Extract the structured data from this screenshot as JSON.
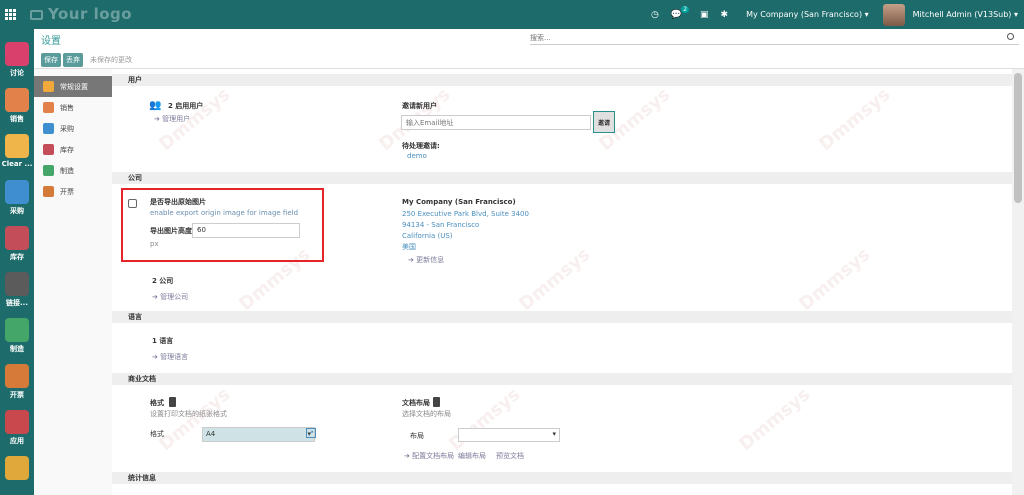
{
  "topbar": {
    "logo": "Your logo",
    "badge_count": "2",
    "company": "My Company (San Francisco)",
    "user": "Mitchell Admin (V13Sub)"
  },
  "apps": [
    {
      "label": "讨论",
      "color": "#d9416c"
    },
    {
      "label": "销售",
      "color": "#e2824a"
    },
    {
      "label": "Clear ...",
      "color": "#f0b54a"
    },
    {
      "label": "采购",
      "color": "#3f8fd0"
    },
    {
      "label": "库存",
      "color": "#c44d5a"
    },
    {
      "label": "链接...",
      "color": "#5b5b5b"
    },
    {
      "label": "制造",
      "color": "#45a66a"
    },
    {
      "label": "开票",
      "color": "#d67a3a"
    },
    {
      "label": "应用",
      "color": "#c8484d"
    },
    {
      "label": "",
      "color": "#e0a83a"
    }
  ],
  "control_panel": {
    "title": "设置",
    "search_placeholder": "搜索...",
    "save": "保存",
    "discard": "丢弃",
    "unsaved": "未保存的更改"
  },
  "sidebar": [
    {
      "label": "常规设置",
      "color": "#f0a93a",
      "active": true
    },
    {
      "label": "销售",
      "color": "#e2824a"
    },
    {
      "label": "采购",
      "color": "#3f8fd0"
    },
    {
      "label": "库存",
      "color": "#c44d5a"
    },
    {
      "label": "制造",
      "color": "#45a66a"
    },
    {
      "label": "开票",
      "color": "#d67a3a"
    }
  ],
  "users": {
    "section": "用户",
    "active_users": "2 启用用户",
    "manage_users": "➔ 管理用户",
    "invite_label": "邀请新用户",
    "invite_placeholder": "输入Email地址",
    "invite_button": "邀请",
    "pending_label": "待处理邀请:",
    "pending_user": "demo"
  },
  "company": {
    "section": "公司",
    "export_title": "是否导出原始图片",
    "export_desc": "enable export origin image for image field",
    "height_label": "导出图片高度",
    "height_value": "60",
    "height_unit": "px",
    "company_name": "My Company (San Francisco)",
    "address_1": "250 Executive Park Blvd, Suite 3400",
    "address_2": "94134 - San Francisco",
    "address_3": "California (US)",
    "address_4": "美国",
    "update_info": "➔ 更新信息",
    "companies_count": "2 公司",
    "manage_companies": "➔ 管理公司"
  },
  "languages": {
    "section": "语言",
    "count": "1 语言",
    "manage": "➔ 管理语言"
  },
  "business_docs": {
    "section": "商业文档",
    "format_title": "格式",
    "format_desc": "设置打印文档的纸张格式",
    "format_label": "格式",
    "format_value": "A4",
    "layout_title": "文档布局",
    "layout_desc": "选择文档的布局",
    "layout_label": "布局",
    "configure_layout": "➔ 配置文档布局",
    "edit_layout": "编辑布局",
    "preview": "预览文档"
  },
  "stats": {
    "section": "统计信息"
  },
  "watermark": "Dmmsys"
}
